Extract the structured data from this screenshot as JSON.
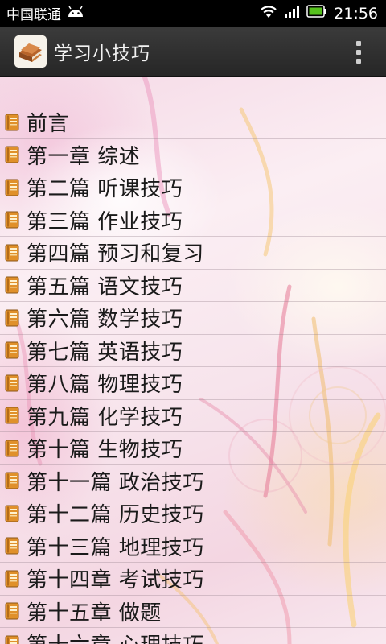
{
  "status_bar": {
    "carrier": "中国联通",
    "time": "21:56",
    "icons": [
      "android-icon",
      "wifi-icon",
      "signal-icon",
      "battery-icon"
    ]
  },
  "action_bar": {
    "title": "学习小技巧",
    "app_icon": "book-app-icon",
    "menu_icon": "overflow-menu-icon"
  },
  "chapters": [
    "前言",
    "第一章 综述",
    "第二篇 听课技巧",
    "第三篇 作业技巧",
    "第四篇 预习和复习",
    "第五篇 语文技巧",
    "第六篇 数学技巧",
    "第七篇 英语技巧",
    "第八篇 物理技巧",
    "第九篇 化学技巧",
    "第十篇 生物技巧",
    "第十一篇 政治技巧",
    "第十二篇 历史技巧",
    "第十三篇 地理技巧",
    "第十四章 考试技巧",
    "第十五章 做题",
    "第十六章 心理技巧"
  ],
  "colors": {
    "status_bar_bg": "#000000",
    "action_bar_bg": "#2e2e2e",
    "battery_green": "#56c11d",
    "book_icon": "#e0902a"
  }
}
